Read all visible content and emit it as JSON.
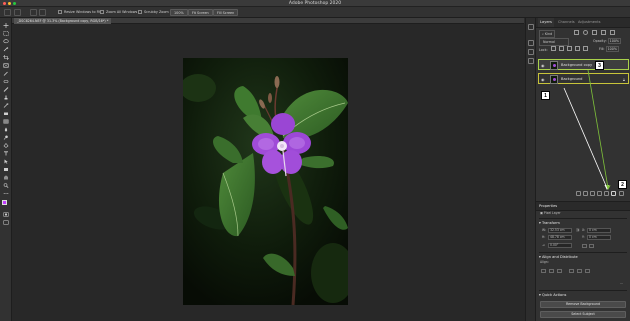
{
  "app": {
    "title": "Adobe Photoshop 2020"
  },
  "options_bar": {
    "resize_windows_label": "Resize Windows to Fit",
    "zoom_all_windows_label": "Zoom All Windows",
    "scrubby_zoom_label": "Scrubby Zoom",
    "zoom_percent_label": "100%",
    "fit_screen_label": "Fit Screen",
    "fill_screen_label": "Fill Screen"
  },
  "document_tab": {
    "label": "_DSC6264.NEF @ 31.3% (Background copy, RGB/16*) *"
  },
  "layers_panel": {
    "tabs": [
      "Layers",
      "Channels",
      "Adjustments"
    ],
    "kind_label": "Kind",
    "blend_mode": "Normal",
    "opacity_label": "Opacity:",
    "opacity_value": "100%",
    "lock_label": "Lock:",
    "fill_label": "Fill:",
    "fill_value": "100%",
    "layers": [
      {
        "name": "Background copy",
        "selected": true
      },
      {
        "name": "Background",
        "selected": false,
        "locked": true
      }
    ]
  },
  "callouts": [
    "1",
    "2",
    "3"
  ],
  "properties_panel": {
    "title": "Properties",
    "layer_type_label": "Pixel Layer",
    "transform_label": "Transform",
    "w_label": "W:",
    "w_value": "32.53 cm",
    "h_label": "H:",
    "h_value": "48.78 cm",
    "x_label": "X:",
    "x_value": "0 cm",
    "y_label": "Y:",
    "y_value": "0 cm",
    "angle_value": "0.00°",
    "align_label": "Align and Distribute",
    "align_sub_label": "Align:",
    "quick_actions_label": "Quick Actions",
    "remove_bg_label": "Remove Background",
    "select_subject_label": "Select Subject"
  },
  "colors": {
    "accent_green": "#a9d14b",
    "accent_yellow": "#c8c43a",
    "flower_purple": "#a04cd8"
  }
}
